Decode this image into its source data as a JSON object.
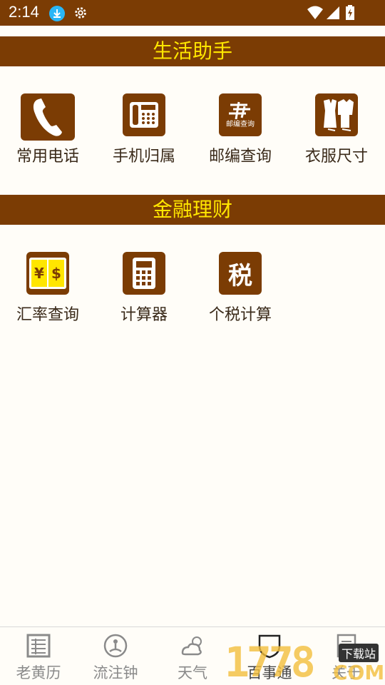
{
  "status_bar": {
    "time": "2:14"
  },
  "sections": [
    {
      "title": "生活助手",
      "items": [
        {
          "label": "常用电话",
          "icon": "phone-handset-icon"
        },
        {
          "label": "手机归属",
          "icon": "desk-phone-icon"
        },
        {
          "label": "邮编查询",
          "icon": "postal-code-icon",
          "icon_text": "邮编查询"
        },
        {
          "label": "衣服尺寸",
          "icon": "clothes-icon"
        }
      ]
    },
    {
      "title": "金融理财",
      "items": [
        {
          "label": "汇率查询",
          "icon": "currency-exchange-icon",
          "icon_text_a": "¥",
          "icon_text_b": "$"
        },
        {
          "label": "计算器",
          "icon": "calculator-icon"
        },
        {
          "label": "个税计算",
          "icon": "tax-icon",
          "icon_text": "税"
        }
      ]
    }
  ],
  "bottom_nav": {
    "items": [
      {
        "label": "老黄历",
        "icon": "calendar-icon"
      },
      {
        "label": "流注钟",
        "icon": "meditation-clock-icon"
      },
      {
        "label": "天气",
        "icon": "weather-icon"
      },
      {
        "label": "百事通",
        "icon": "shield-icon",
        "active": true
      },
      {
        "label": "关于",
        "icon": "about-icon"
      }
    ]
  },
  "watermark": {
    "text": "1778",
    "suffix": "COM",
    "badge": "下载站"
  },
  "colors": {
    "brand": "#7b3c04",
    "header_text": "#ffe600",
    "background": "#fffdf8"
  }
}
